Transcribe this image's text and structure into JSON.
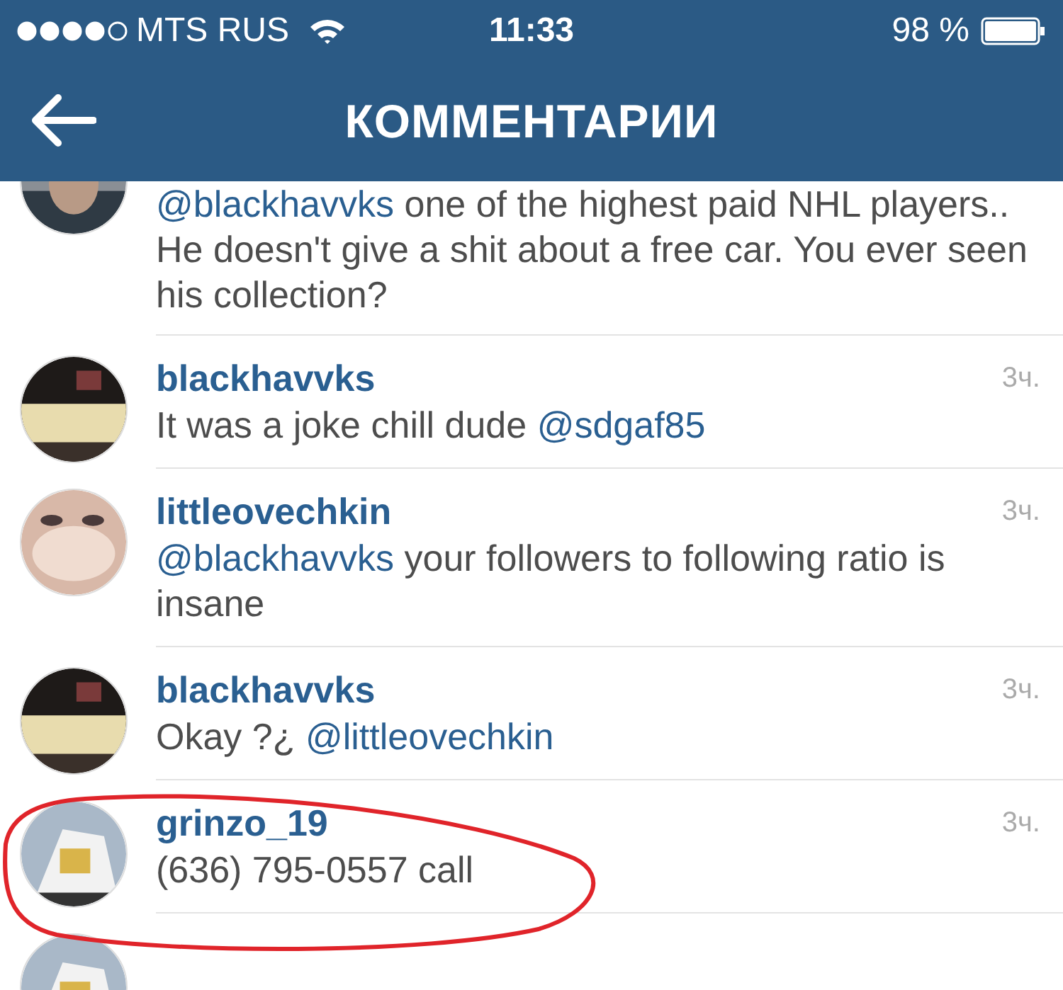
{
  "status_bar": {
    "carrier": "MTS RUS",
    "time": "11:33",
    "battery": "98 %"
  },
  "header": {
    "title": "КОММЕНТАРИИ"
  },
  "comments": [
    {
      "segments": [
        {
          "kind": "mention",
          "text": "@blackhavvks"
        },
        {
          "kind": "plain",
          "text": " one of the highest paid NHL players.. He doesn't give a shit about a free car. You ever seen his collection?"
        }
      ]
    },
    {
      "username": "blackhavvks",
      "time": "3ч.",
      "segments": [
        {
          "kind": "plain",
          "text": "It was a joke chill dude "
        },
        {
          "kind": "mention",
          "text": "@sdgaf85"
        }
      ]
    },
    {
      "username": "littleovechkin",
      "time": "3ч.",
      "segments": [
        {
          "kind": "mention",
          "text": "@blackhavvks"
        },
        {
          "kind": "plain",
          "text": " your followers to following ratio is insane"
        }
      ]
    },
    {
      "username": "blackhavvks",
      "time": "3ч.",
      "segments": [
        {
          "kind": "plain",
          "text": "Okay ?¿ "
        },
        {
          "kind": "mention",
          "text": "@littleovechkin"
        }
      ]
    },
    {
      "username": "grinzo_19",
      "time": "3ч.",
      "segments": [
        {
          "kind": "plain",
          "text": "(636) 795-0557 call"
        }
      ]
    }
  ]
}
